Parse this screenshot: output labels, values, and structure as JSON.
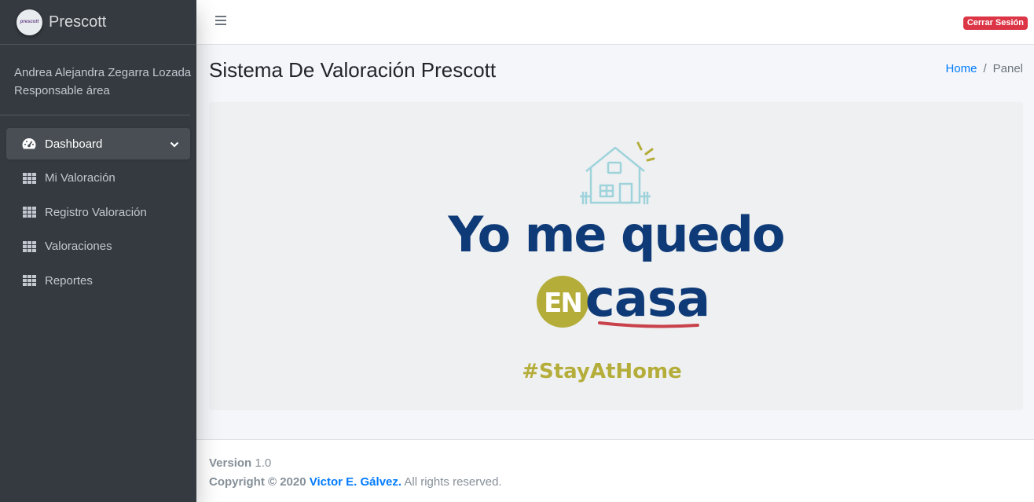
{
  "brand": {
    "name": "Prescott",
    "logo_text": "prescott"
  },
  "user": {
    "name": "Andrea Alejandra Zegarra Lozada",
    "role": "Responsable área"
  },
  "nav": {
    "items": [
      {
        "label": "Dashboard",
        "icon": "dashboard-icon",
        "active": true
      },
      {
        "label": "Mi Valoración",
        "icon": "grid-icon"
      },
      {
        "label": "Registro Valoración",
        "icon": "grid-icon"
      },
      {
        "label": "Valoraciones",
        "icon": "grid-icon"
      },
      {
        "label": "Reportes",
        "icon": "grid-icon"
      }
    ]
  },
  "topbar": {
    "logout_label": "Cerrar Sesión",
    "menu_icon": "hamburger-icon"
  },
  "header": {
    "title": "Sistema De Valoración Prescott"
  },
  "breadcrumb": {
    "home": "Home",
    "separator": "/",
    "current": "Panel"
  },
  "banner": {
    "line1": "Yo me quedo",
    "badge": "EN",
    "line2": "casa",
    "hashtag": "#StayAtHome"
  },
  "footer": {
    "version_label": "Version",
    "version_value": "1.0",
    "copyright_prefix": "Copyright © 2020",
    "author": "Victor E. Gálvez.",
    "rights": "All rights reserved."
  },
  "colors": {
    "sidebar_bg": "#343a40",
    "accent_blue": "#007bff",
    "danger": "#dc3545",
    "banner_navy": "#0f3a78",
    "banner_olive": "#b5ad3a",
    "banner_red": "#c8414b",
    "house_teal": "#9fd3dc"
  }
}
